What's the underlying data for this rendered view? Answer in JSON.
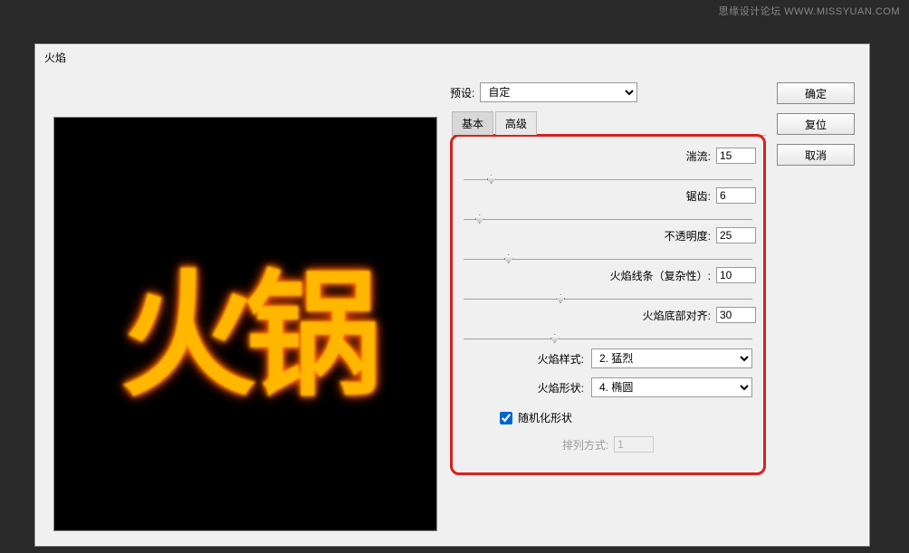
{
  "watermark": "思缘设计论坛  WWW.MISSYUAN.COM",
  "dialog": {
    "title": "火焰",
    "preview_text": "火锅",
    "preset": {
      "label": "预设:",
      "value": "自定"
    },
    "tabs": {
      "basic": "基本",
      "advanced": "高级"
    },
    "sliders": {
      "turbulence": {
        "label": "湍流:",
        "value": "15",
        "pos": 8
      },
      "jag": {
        "label": "锯齿:",
        "value": "6",
        "pos": 4
      },
      "opacity": {
        "label": "不透明度:",
        "value": "25",
        "pos": 14
      },
      "complexity": {
        "label": "火焰线条（复杂性）:",
        "value": "10",
        "pos": 32
      },
      "alignment": {
        "label": "火焰底部对齐:",
        "value": "30",
        "pos": 30
      }
    },
    "selects": {
      "style": {
        "label": "火焰样式:",
        "value": "2. 猛烈"
      },
      "shape": {
        "label": "火焰形状:",
        "value": "4. 椭圆"
      }
    },
    "checkbox": {
      "label": "随机化形状",
      "checked": true
    },
    "arrangement": {
      "label": "排列方式:",
      "value": "1"
    },
    "buttons": {
      "ok": "确定",
      "reset": "复位",
      "cancel": "取消"
    }
  }
}
